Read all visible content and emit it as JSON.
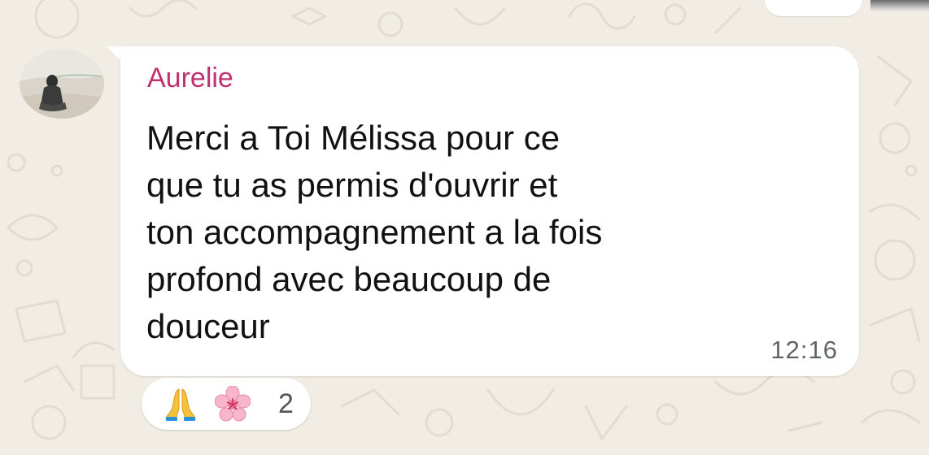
{
  "chat": {
    "message": {
      "sender": "Aurelie",
      "text": "Merci a Toi Mélissa pour ce\nque tu as permis d'ouvrir et\nton accompagnement a la fois\nprofond avec beaucoup de\ndouceur",
      "time": "12:16"
    },
    "reactions": {
      "emojis": [
        "folded-hands",
        "cherry-blossom"
      ],
      "count": "2"
    }
  },
  "colors": {
    "wallpaper": "#f1ece4",
    "bubble": "#ffffff",
    "sender_name": "#c2306e",
    "message_text": "#111111",
    "timestamp": "#5f6467"
  },
  "icons": {
    "avatar": "profile-photo",
    "reaction_1": "folded-hands-icon",
    "reaction_2": "cherry-blossom-icon"
  }
}
